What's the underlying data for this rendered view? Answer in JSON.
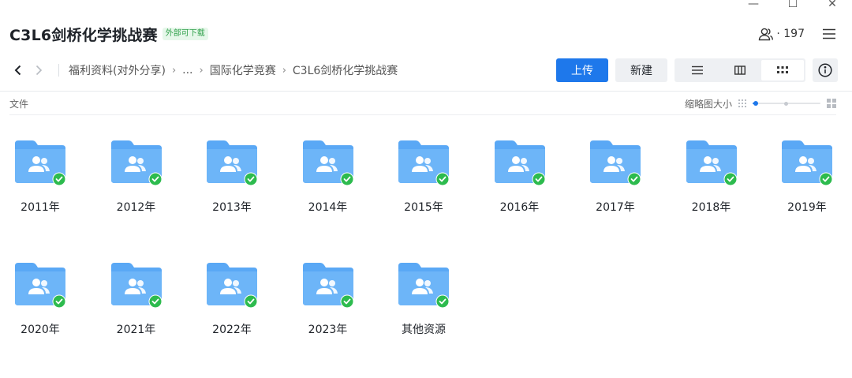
{
  "window": {
    "minimize": "—",
    "maximize": "☐",
    "close": "✕"
  },
  "header": {
    "title": "C3L6剑桥化学挑战赛",
    "badge": "外部可下载",
    "member_count": "· 197"
  },
  "breadcrumb": [
    "福利资料(对外分享)",
    "...",
    "国际化学竞赛",
    "C3L6剑桥化学挑战赛"
  ],
  "toolbar": {
    "upload_label": "上传",
    "new_label": "新建",
    "active_view": "grid"
  },
  "subbar": {
    "files_label": "文件",
    "thumb_size_label": "缩略图大小",
    "thumb_size_level": 0.05
  },
  "colors": {
    "accent": "#1e78eb",
    "folder": "#5aa8f5",
    "check": "#2dbb4e"
  },
  "folders": [
    {
      "name": "2011年",
      "icon": "shared-folder-icon",
      "synced": true
    },
    {
      "name": "2012年",
      "icon": "shared-folder-icon",
      "synced": true
    },
    {
      "name": "2013年",
      "icon": "shared-folder-icon",
      "synced": true
    },
    {
      "name": "2014年",
      "icon": "shared-folder-icon",
      "synced": true
    },
    {
      "name": "2015年",
      "icon": "shared-folder-icon",
      "synced": true
    },
    {
      "name": "2016年",
      "icon": "shared-folder-icon",
      "synced": true
    },
    {
      "name": "2017年",
      "icon": "shared-folder-icon",
      "synced": true
    },
    {
      "name": "2018年",
      "icon": "shared-folder-icon",
      "synced": true
    },
    {
      "name": "2019年",
      "icon": "shared-folder-icon",
      "synced": true
    },
    {
      "name": "2020年",
      "icon": "shared-folder-icon",
      "synced": true
    },
    {
      "name": "2021年",
      "icon": "shared-folder-icon",
      "synced": true
    },
    {
      "name": "2022年",
      "icon": "shared-folder-icon",
      "synced": true
    },
    {
      "name": "2023年",
      "icon": "shared-folder-icon",
      "synced": true
    },
    {
      "name": "其他资源",
      "icon": "shared-folder-icon",
      "synced": true
    }
  ]
}
